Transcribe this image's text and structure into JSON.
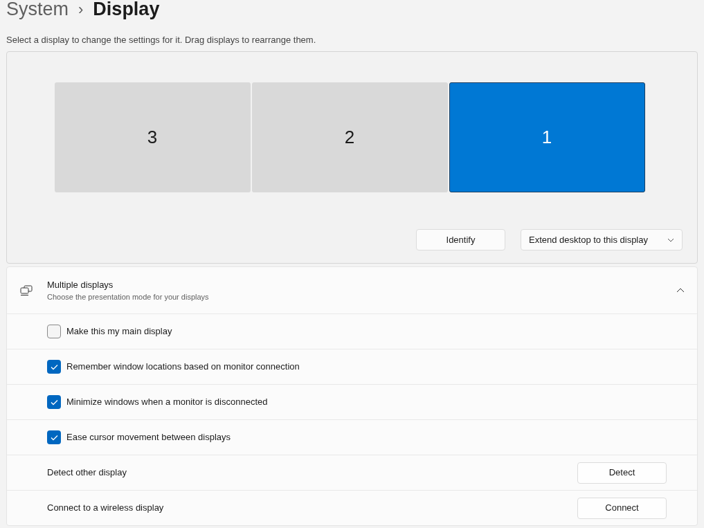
{
  "breadcrumb": {
    "parent": "System",
    "separator": "›",
    "current": "Display"
  },
  "description": "Select a display to change the settings for it. Drag displays to rearrange them.",
  "displays": [
    {
      "label": "3",
      "selected": false
    },
    {
      "label": "2",
      "selected": false
    },
    {
      "label": "1",
      "selected": true
    }
  ],
  "identify_button": "Identify",
  "mode_dropdown": {
    "value": "Extend desktop to this display"
  },
  "multiple_displays": {
    "title": "Multiple displays",
    "subtitle": "Choose the presentation mode for your displays",
    "expanded": true,
    "options": [
      {
        "label": "Make this my main display",
        "checked": false
      },
      {
        "label": "Remember window locations based on monitor connection",
        "checked": true
      },
      {
        "label": "Minimize windows when a monitor is disconnected",
        "checked": true
      },
      {
        "label": "Ease cursor movement between displays",
        "checked": true
      }
    ],
    "actions": [
      {
        "label": "Detect other display",
        "button": "Detect"
      },
      {
        "label": "Connect to a wireless display",
        "button": "Connect"
      }
    ]
  }
}
